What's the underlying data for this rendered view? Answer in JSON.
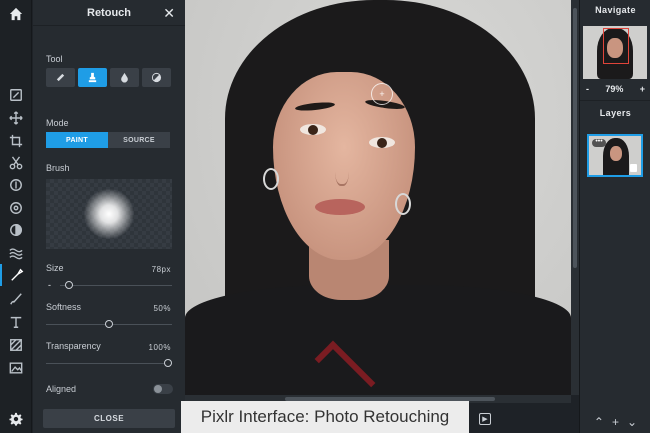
{
  "rail": {
    "home": "home-icon",
    "tools": [
      "crop-icon",
      "move-icon",
      "crop-icon",
      "cut-icon",
      "adjust-icon",
      "filter-icon",
      "liquify-icon",
      "wave-icon",
      "retouch-icon",
      "brush-icon",
      "text-icon",
      "pattern-icon",
      "image-icon"
    ],
    "settings": "settings-icon"
  },
  "panel": {
    "title": "Retouch",
    "close_glyph": "✕",
    "tool_label": "Tool",
    "mode_label": "Mode",
    "mode_paint": "PAINT",
    "mode_source": "SOURCE",
    "brush_label": "Brush",
    "size_label": "Size",
    "size_value": "78px",
    "softness_label": "Softness",
    "softness_value": "50%",
    "softness_fraction": 0.5,
    "transparency_label": "Transparency",
    "transparency_value": "100%",
    "transparency_fraction": 1.0,
    "aligned_label": "Aligned",
    "close_label": "CLOSE"
  },
  "caption": "Pixlr Interface: Photo Retouching",
  "navigate": {
    "title": "Navigate",
    "zoom_out": "-",
    "zoom": "79%",
    "zoom_in": "+"
  },
  "layers": {
    "title": "Layers",
    "dots": "•••"
  },
  "colors": {
    "accent": "#1f9de6"
  }
}
